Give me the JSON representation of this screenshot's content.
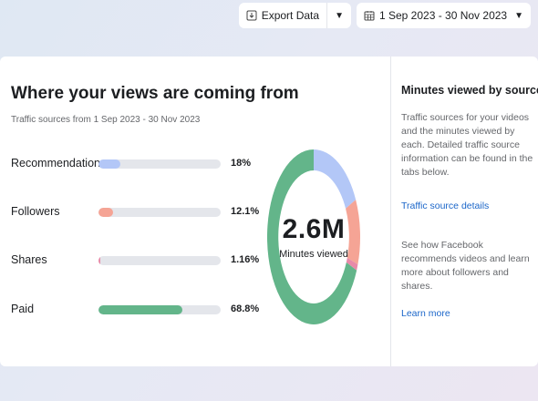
{
  "toolbar": {
    "export_label": "Export Data",
    "date_range": "1 Sep 2023 - 30 Nov 2023"
  },
  "main": {
    "title": "Where your views are coming from",
    "subtitle": "Traffic sources from 1 Sep 2023 - 30 Nov 2023",
    "sources": [
      {
        "label": "Recommendations",
        "percent_text": "18%",
        "value": 18.0,
        "color": "#b3c7f7"
      },
      {
        "label": "Followers",
        "percent_text": "12.1%",
        "value": 12.1,
        "color": "#f5a495"
      },
      {
        "label": "Shares",
        "percent_text": "1.16%",
        "value": 1.16,
        "color": "#e88aa8"
      },
      {
        "label": "Paid",
        "percent_text": "68.8%",
        "value": 68.8,
        "color": "#63b58a"
      }
    ],
    "donut": {
      "total": "2.6M",
      "caption": "Minutes viewed"
    }
  },
  "sidebar": {
    "title": "Minutes viewed by source",
    "description": "Traffic sources for your videos and the minutes viewed by each. Detailed traffic source information can be found in the tabs below.",
    "details_link": "Traffic source details",
    "recommend_text": "See how Facebook recommends videos and learn more about followers and shares.",
    "learn_more": "Learn more"
  }
}
